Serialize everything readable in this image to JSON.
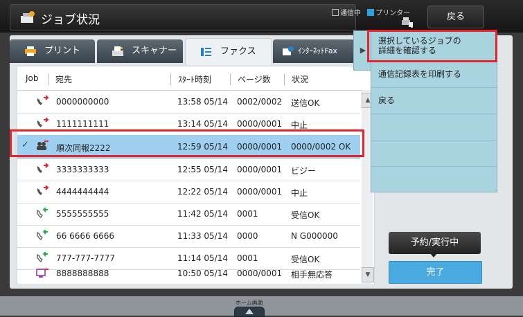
{
  "header": {
    "title": "ジョブ状況",
    "status_sending": "通信中",
    "status_printer": "プリンター",
    "back_label": "戻る"
  },
  "tabs": [
    {
      "label": "プリント"
    },
    {
      "label": "スキャナー"
    },
    {
      "label": "ファクス"
    },
    {
      "label": "ｲﾝﾀｰﾈｯﾄFax"
    }
  ],
  "table": {
    "headers": {
      "job": "Job",
      "dest": "宛先",
      "start": "ｽﾀｰﾄ時刻",
      "pages": "ページ数",
      "status": "状況"
    },
    "rows": [
      {
        "dest": "0000000000",
        "time": "13:58 05/14",
        "pages": "0002/0002",
        "status": "送信OK"
      },
      {
        "dest": "1111111111",
        "time": "13:14 05/14",
        "pages": "0000/0001",
        "status": "中止"
      },
      {
        "dest": "順次同報2222",
        "time": "12:59 05/14",
        "pages": "0000/0001",
        "status": "0000/0002 OK"
      },
      {
        "dest": "3333333333",
        "time": "12:55 05/14",
        "pages": "0000/0001",
        "status": "ビジー"
      },
      {
        "dest": "4444444444",
        "time": "12:22 05/14",
        "pages": "0000/0001",
        "status": "中止"
      },
      {
        "dest": "5555555555",
        "time": "11:42 05/14",
        "pages": "0001",
        "status": "受信OK"
      },
      {
        "dest": "66 6666 6666",
        "time": "11:33 05/14",
        "pages": "0000",
        "status": "N G000000"
      },
      {
        "dest": "777-777-7777",
        "time": "11:14 05/14",
        "pages": "0001",
        "status": "受信OK"
      },
      {
        "dest": "8888888888",
        "time": "10:50 05/14",
        "pages": "0000/0001",
        "status": "相手無応答"
      }
    ]
  },
  "actions": {
    "check_details_line1": "選択しているジョブの",
    "check_details_line2": "詳細を確認する",
    "print_log": "通信記録表を印刷する",
    "back": "戻る"
  },
  "buttons": {
    "reserve": "予約/実行中",
    "complete": "完了"
  },
  "home": {
    "label": "ホーム画面"
  },
  "colors": {
    "accent": "#4aa9df",
    "highlight": "#e3262d",
    "selected_row": "#9fd0ef",
    "action_panel": "#a9d3df"
  }
}
